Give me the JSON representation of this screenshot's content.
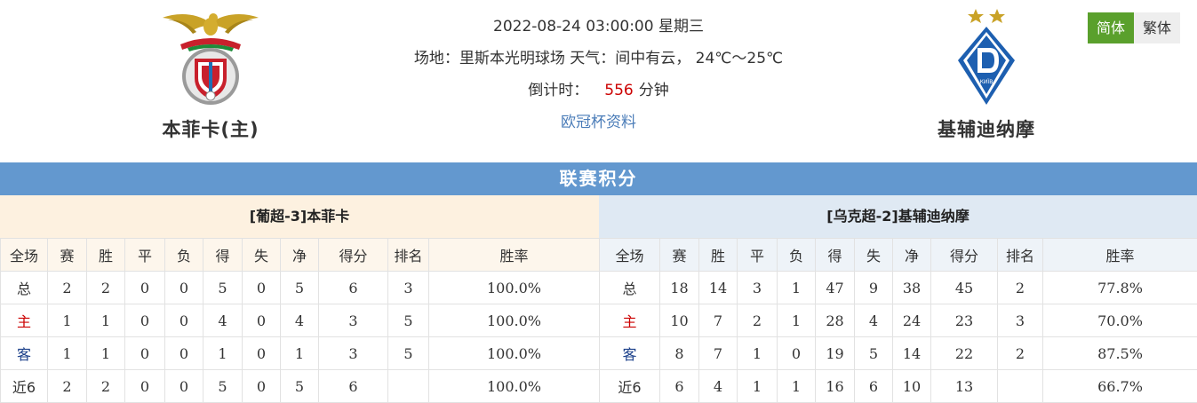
{
  "header": {
    "datetime": "2022-08-24 03:00:00",
    "weekday": "星期三",
    "venue_line": "场地：里斯本光明球场 天气：间中有云， 24℃～25℃",
    "countdown_label": "倒计时：",
    "countdown_value": "556",
    "countdown_unit": "分钟",
    "competition_link": "欧冠杯资料"
  },
  "home_team": {
    "name": "本菲卡(主)",
    "logo_icon": "benfica-crest-icon"
  },
  "away_team": {
    "name": "基辅迪纳摩",
    "logo_icon": "dynamo-kyiv-crest-icon"
  },
  "lang": {
    "simplified": "简体",
    "traditional": "繁体",
    "active": "simplified"
  },
  "standings": {
    "title": "联赛积分",
    "columns": [
      "全场",
      "赛",
      "胜",
      "平",
      "负",
      "得",
      "失",
      "净",
      "得分",
      "排名",
      "胜率"
    ],
    "home": {
      "heading": "[葡超-3]本菲卡",
      "rows": [
        {
          "label": "总",
          "cells": [
            "2",
            "2",
            "0",
            "0",
            "5",
            "0",
            "5",
            "6",
            "3",
            "100.0%"
          ]
        },
        {
          "label": "主",
          "cells": [
            "1",
            "1",
            "0",
            "0",
            "4",
            "0",
            "4",
            "3",
            "5",
            "100.0%"
          ]
        },
        {
          "label": "客",
          "cells": [
            "1",
            "1",
            "0",
            "0",
            "1",
            "0",
            "1",
            "3",
            "5",
            "100.0%"
          ]
        },
        {
          "label": "近6",
          "cells": [
            "2",
            "2",
            "0",
            "0",
            "5",
            "0",
            "5",
            "6",
            "",
            "100.0%"
          ]
        }
      ]
    },
    "away": {
      "heading": "[乌克超-2]基辅迪纳摩",
      "rows": [
        {
          "label": "总",
          "cells": [
            "18",
            "14",
            "3",
            "1",
            "47",
            "9",
            "38",
            "45",
            "2",
            "77.8%"
          ]
        },
        {
          "label": "主",
          "cells": [
            "10",
            "7",
            "2",
            "1",
            "28",
            "4",
            "24",
            "23",
            "3",
            "70.0%"
          ]
        },
        {
          "label": "客",
          "cells": [
            "8",
            "7",
            "1",
            "0",
            "19",
            "5",
            "14",
            "22",
            "2",
            "87.5%"
          ]
        },
        {
          "label": "近6",
          "cells": [
            "6",
            "4",
            "1",
            "1",
            "16",
            "6",
            "10",
            "13",
            "",
            "66.7%"
          ]
        }
      ]
    }
  },
  "colors": {
    "title_bar": "#6398cf",
    "lang_active": "#5aa02c",
    "home_label": "#cc0000",
    "away_label": "#1a3f8a",
    "countdown": "#cc0000"
  }
}
